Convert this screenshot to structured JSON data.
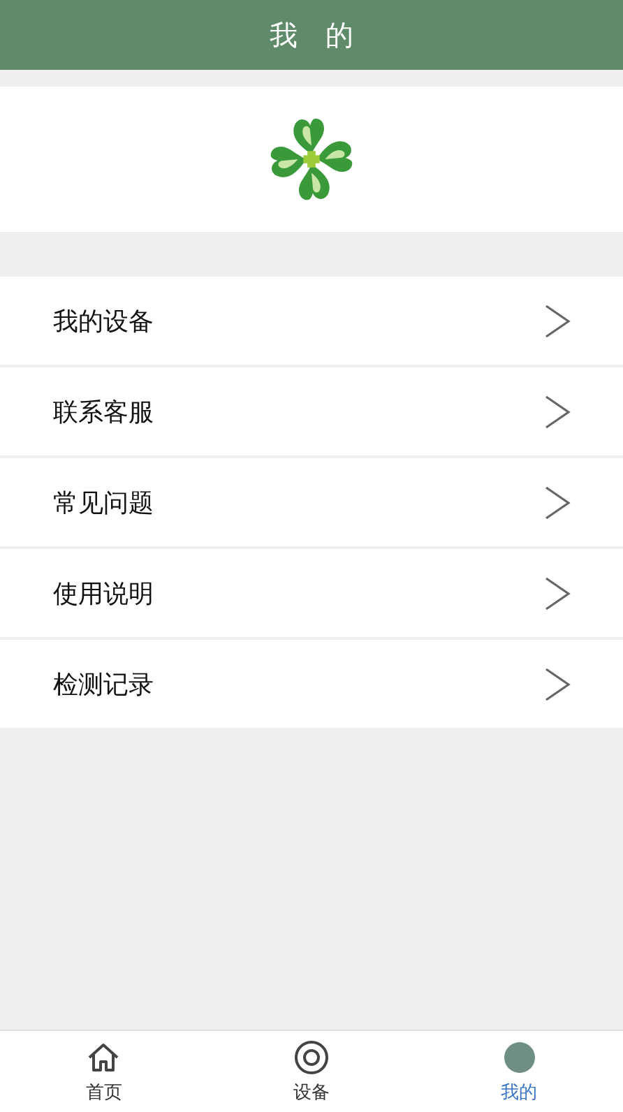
{
  "header": {
    "title": "我　的"
  },
  "menu": [
    {
      "label": "我的设备"
    },
    {
      "label": "联系客服"
    },
    {
      "label": "常见问题"
    },
    {
      "label": "使用说明"
    },
    {
      "label": "检测记录"
    }
  ],
  "tab_bar": [
    {
      "kind": "home",
      "label": "首页",
      "selected": false
    },
    {
      "kind": "device",
      "label": "设备",
      "selected": false
    },
    {
      "kind": "profile",
      "label": "我的",
      "selected": true
    }
  ]
}
